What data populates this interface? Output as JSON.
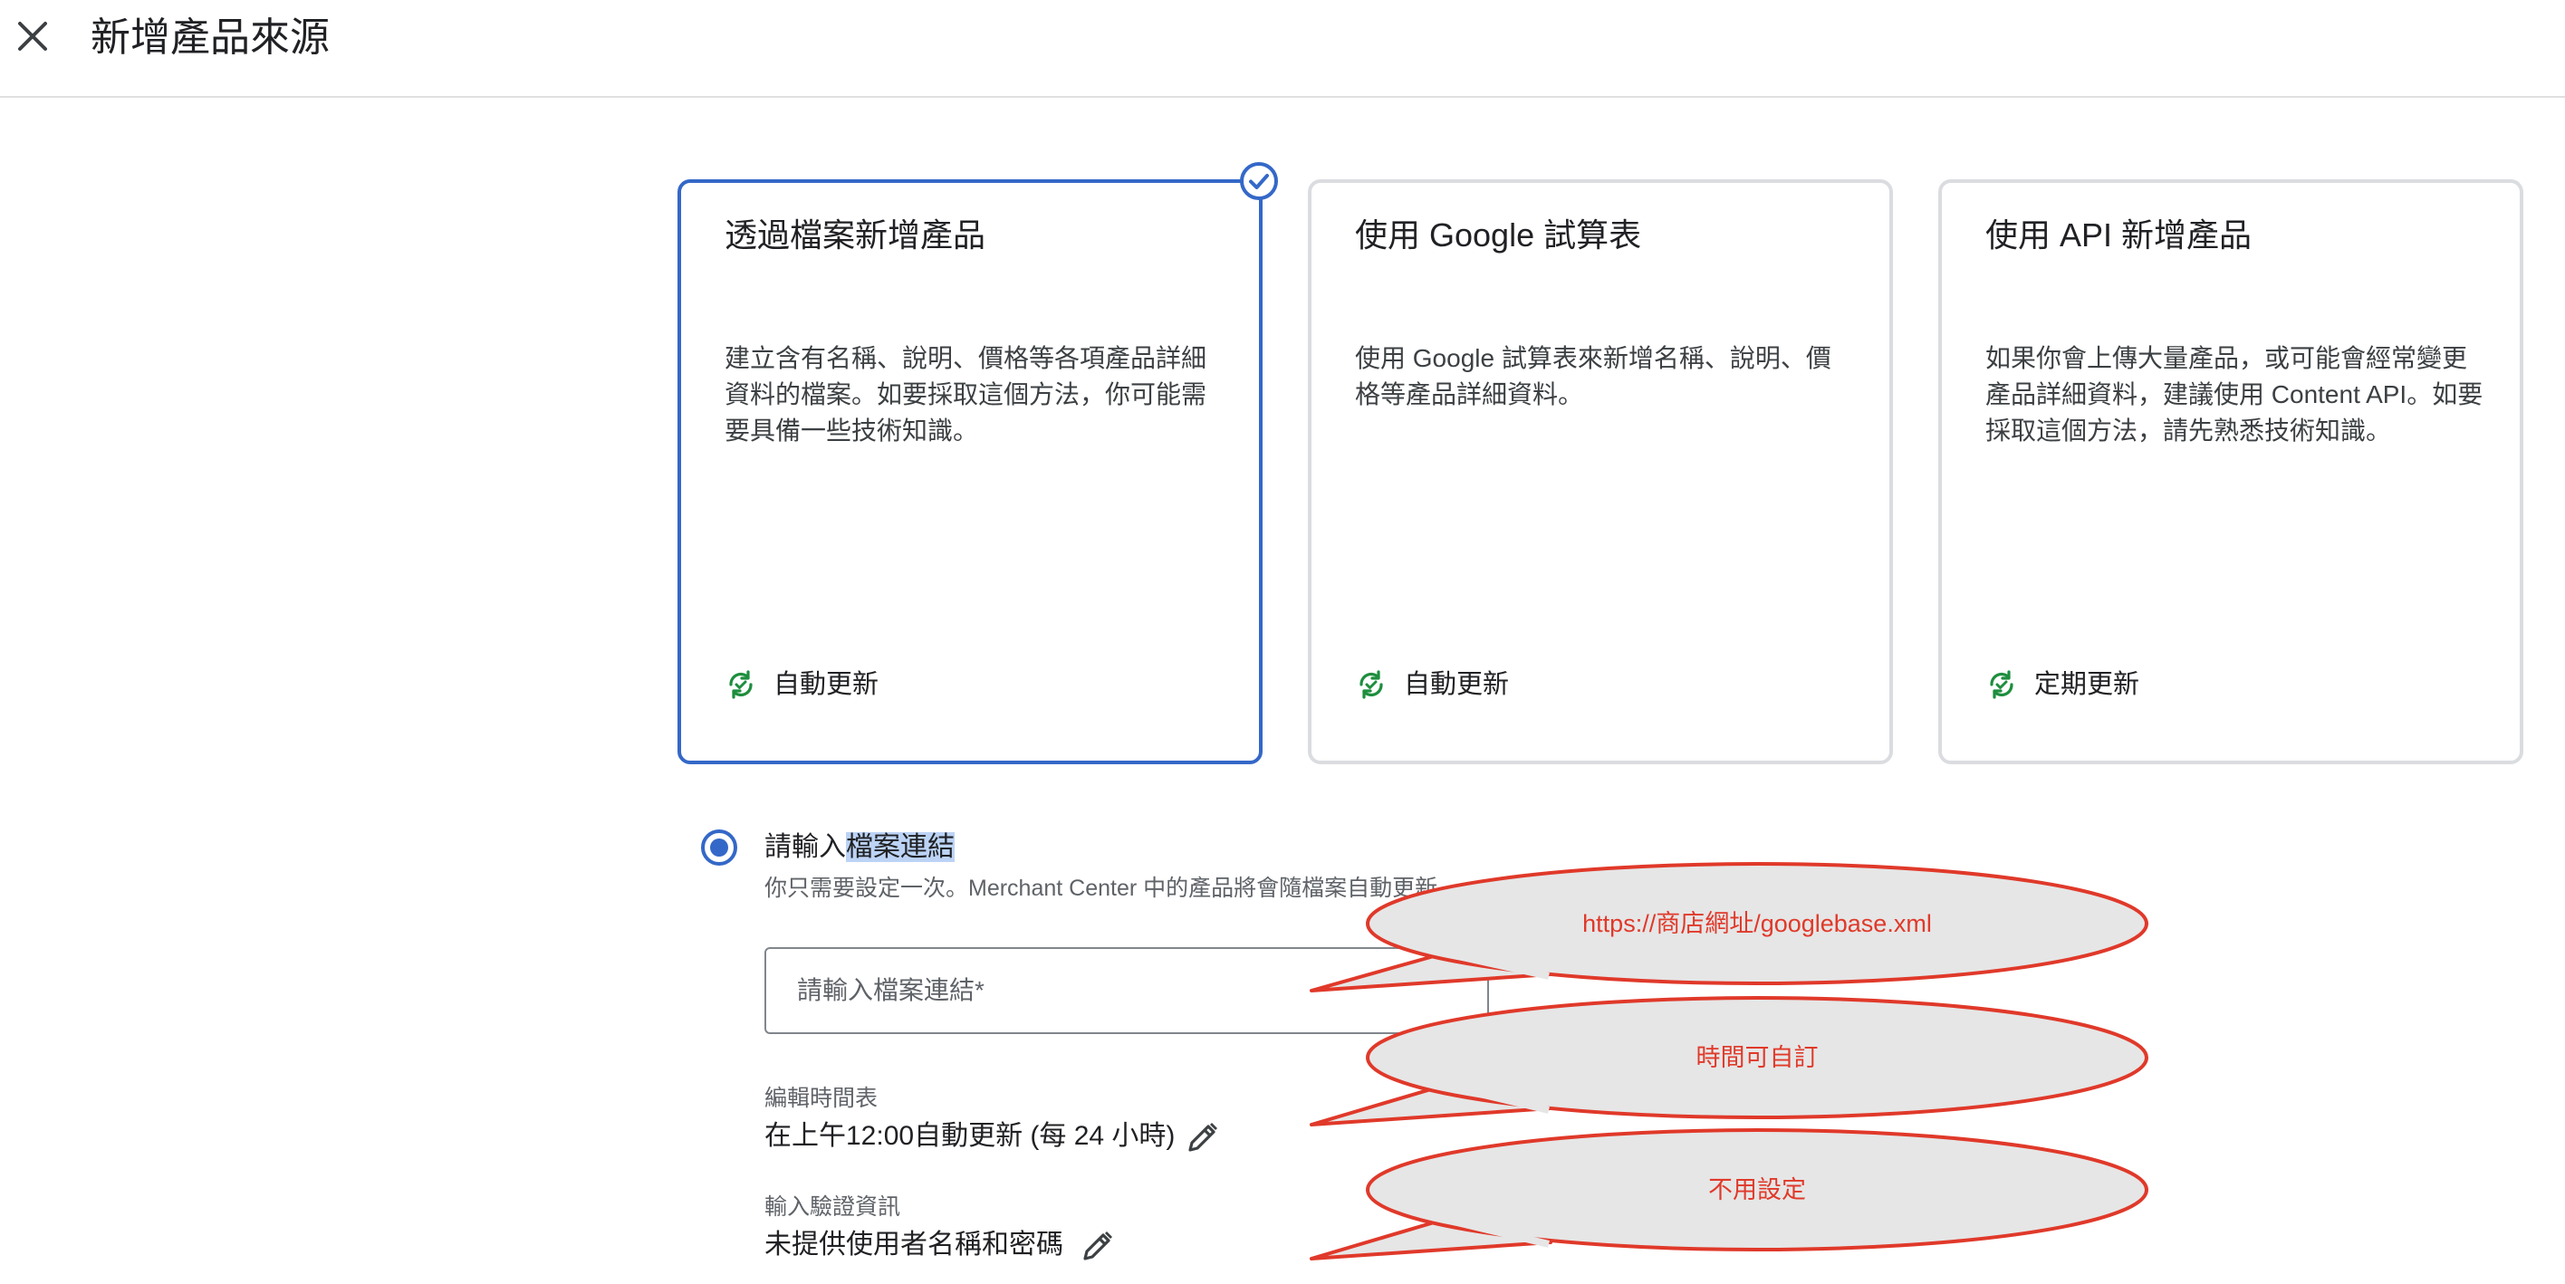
{
  "header": {
    "title": "新增產品來源",
    "close_icon": "close-icon"
  },
  "cards": [
    {
      "title": "透過檔案新增產品",
      "description": "建立含有名稱、說明、價格等各項產品詳細資料的檔案。如要採取這個方法，你可能需要具備一些技術知識。",
      "footer": "自動更新",
      "selected": true
    },
    {
      "title": "使用 Google 試算表",
      "description": "使用 Google 試算表來新增名稱、說明、價格等產品詳細資料。",
      "footer": "自動更新",
      "selected": false
    },
    {
      "title": "使用 API 新增產品",
      "description": "如果你會上傳大量產品，或可能會經常變更產品詳細資料，建議使用 Content API。如要採取這個方法，請先熟悉技術知識。",
      "footer": "定期更新",
      "selected": false
    }
  ],
  "file_option": {
    "label_prefix": "請輸入",
    "label_highlight": "檔案連結",
    "subtitle": "你只需要設定一次。Merchant Center 中的產品將會隨檔案自動更新。",
    "input_placeholder": "請輸入檔案連結*",
    "input_value": ""
  },
  "schedule": {
    "label": "編輯時間表",
    "value": "在上午12:00自動更新 (每 24 小時)"
  },
  "credentials": {
    "label": "輸入驗證資訊",
    "value": "未提供使用者名稱和密碼"
  },
  "annotations": [
    {
      "text": "https://商店網址/googlebase.xml"
    },
    {
      "text": "時間可自訂"
    },
    {
      "text": "不用設定"
    }
  ],
  "colors": {
    "accent": "#3468c8",
    "refresh_icon": "#1e8e3e",
    "callout_stroke": "#e0392a",
    "callout_fill": "#e6e6e6"
  }
}
